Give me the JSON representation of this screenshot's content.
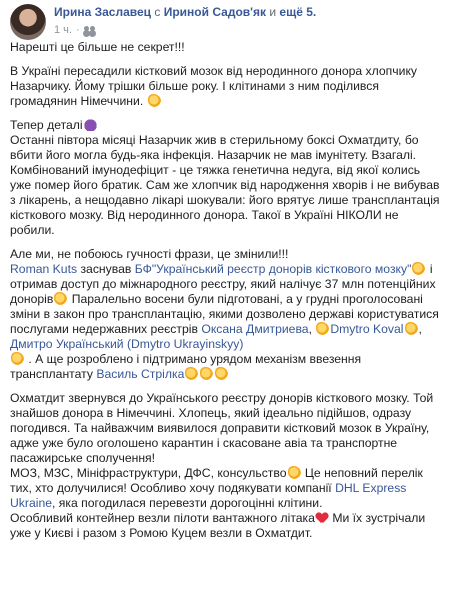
{
  "header": {
    "author": "Ирина Заславец",
    "with_text": "с",
    "tagged": "Ириной Садов'як",
    "and_text": "и",
    "others": "ещё 5.",
    "time": "1 ч.",
    "privacy_icon": "friends-icon"
  },
  "post": {
    "p1": "Нарешті це більше не секрет!!!",
    "p2": "В Україні пересадили кістковий мозок від неродинного донора хлопчику Назарчику. Йому трішки більше року. І клітинами з ним поділився громадянин Німеччини.",
    "p3a": "Тепер деталі",
    "p3b": "Останні півтора місяці Назарчик жив в стерильному боксі Охматдиту, бо вбити його могла будь-яка інфекція. Назарчик не мав імунітету. Взагалі. Комбінований імунодефіцит - це тяжка генетична недуга, від якої колись уже помер його братик. Сам же хлопчик від народження хворів і не вибував з лікарень, а нещодавно лікарі шокували: його врятує лише трансплантація кісткового мозку. Від неродинного донора. Такої в Україні НІКОЛИ не робили.",
    "p4a": "Але ми, не побоюсь гучності фрази, це змінили!!!",
    "p4_link1": "Roman Kuts",
    "p4_t1": " заснував ",
    "p4_link2": "БФ\"Український реєстр донорів кісткового мозку\"",
    "p4_t2": " і отримав доступ до міжнародного реєстру, який налічує 37 млн потенційних донорів",
    "p4_t3": " Паралельно восени були підготовані, а у грудні проголосовані зміни в закон про трансплантацію, якими дозволено державі користуватися послугами недержавних реєстрів ",
    "p4_link3": "Оксана Дмитриева",
    "p4_sep1": ", ",
    "p4_link4": "Dmytro Koval",
    "p4_sep2": ", ",
    "p4_link5": "Дмитро Украïнський (Dmytro Ukrayinskyy)",
    "p4_t4": " . А ще розроблено і підтримано урядом механізм ввезення трансплантату ",
    "p4_link6": "Василь Стрілка",
    "p5a": "Охматдит звернувся до Українського реєстру донорів кісткового мозку. Той знайшов донора в Німеччині. Хлопець, який ідеально підійшов, одразу погодився. Та найважчим виявилося доправити кістковий мозок в Україну, адже уже було оголошено карантин і скасоване авіа та транспортне пасажирське сполучення!",
    "p5b": "МОЗ, МЗС, Мініфраструктури, ДФС, консульство",
    "p5c": " Це неповний перелік тих, хто долучилися! Особливо хочу подякувати компанії ",
    "p5_link1": "DHL Express Ukraine",
    "p5d": ", яка погодилася перевезти дорогоцінні клітини.",
    "p5e": "Особливий контейнер везли пілоти вантажного літака",
    "p5f": " Ми їх зустрічали уже у Києві і разом з Ромою Куцем везли в Охматдит."
  },
  "icons": {
    "clap": "clapping-hands-icon",
    "devil": "smiling-devil-icon",
    "heart": "red-heart-icon"
  },
  "colors": {
    "link": "#385898",
    "text": "#1c1e21",
    "meta": "#90949c"
  }
}
